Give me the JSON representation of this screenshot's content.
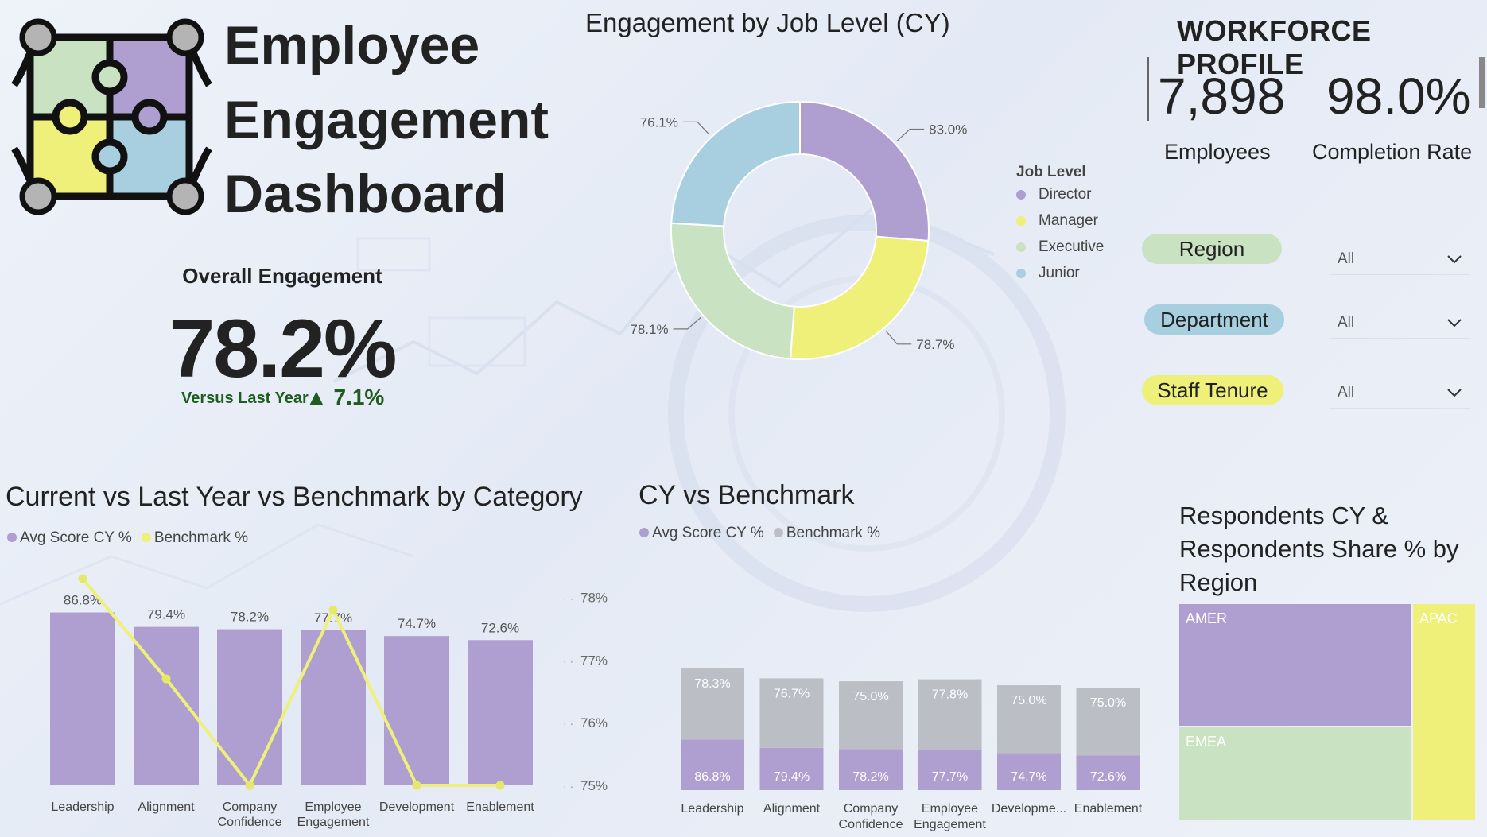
{
  "header": {
    "title_lines": [
      "Employee",
      "Engagement",
      "Dashboard"
    ]
  },
  "kpi": {
    "overall_label": "Overall Engagement",
    "overall_value": "78.2%",
    "vs_label": "Versus Last Year",
    "delta": "▲ 7.1%"
  },
  "colors": {
    "purple": "#ae9fd0",
    "yellow": "#eef07a",
    "green": "#c8e2c2",
    "blue": "#a8cfe0",
    "grey": "#bcbec6",
    "positive": "#1f5c1f"
  },
  "workforce": {
    "title": "WORKFORCE PROFILE",
    "employees_value": "7,898",
    "employees_label": "Employees",
    "completion_value": "98.0%",
    "completion_label": "Completion Rate"
  },
  "filters": [
    {
      "label": "Region",
      "value": "All",
      "color": "#c8e2c2"
    },
    {
      "label": "Department",
      "value": "All",
      "color": "#a8cfe0"
    },
    {
      "label": "Staff Tenure",
      "value": "All",
      "color": "#eef07a"
    }
  ],
  "donut": {
    "title": "Engagement by Job Level (CY)",
    "legend_title": "Job Level",
    "legend": [
      {
        "label": "Director",
        "color": "#ae9fd0"
      },
      {
        "label": "Manager",
        "color": "#eef07a"
      },
      {
        "label": "Executive",
        "color": "#c8e2c2"
      },
      {
        "label": "Junior",
        "color": "#a8cfe0"
      }
    ]
  },
  "category_chart": {
    "title": "Current vs Last Year vs Benchmark by Category",
    "legend": [
      {
        "label": "Avg Score CY %",
        "color": "#ae9fd0"
      },
      {
        "label": "Benchmark %",
        "color": "#eef07a"
      }
    ]
  },
  "cy_bench_chart": {
    "title": "CY vs Benchmark",
    "legend": [
      {
        "label": "Avg Score CY %",
        "color": "#ae9fd0"
      },
      {
        "label": "Benchmark %",
        "color": "#bcbec6"
      }
    ]
  },
  "treemap": {
    "title_lines": [
      "Respondents CY &",
      "Respondents Share % by",
      "Region"
    ]
  },
  "chart_data": [
    {
      "type": "pie",
      "title": "Engagement by Job Level (CY)",
      "categories": [
        "Director",
        "Manager",
        "Executive",
        "Junior"
      ],
      "values": [
        83.0,
        78.7,
        78.1,
        76.1
      ],
      "labels": [
        "83.0%",
        "78.7%",
        "78.1%",
        "76.1%"
      ]
    },
    {
      "type": "bar",
      "title": "Current vs Last Year vs Benchmark by Category",
      "categories": [
        "Leadership",
        "Alignment",
        "Company Confidence",
        "Employee Engagement",
        "Development",
        "Enablement"
      ],
      "category_label_lines": [
        [
          "Leadership"
        ],
        [
          "Alignment"
        ],
        [
          "Company",
          "Confidence"
        ],
        [
          "Employee",
          "Engagement"
        ],
        [
          "Development"
        ],
        [
          "Enablement"
        ]
      ],
      "series": [
        {
          "name": "Avg Score CY %",
          "values": [
            86.8,
            79.4,
            78.2,
            77.7,
            74.7,
            72.6
          ],
          "labels": [
            "86.8%",
            "79.4%",
            "78.2%",
            "77.7%",
            "74.7%",
            "72.6%"
          ]
        },
        {
          "name": "Benchmark %",
          "values": [
            78.3,
            76.7,
            75.0,
            77.8,
            75.0,
            75.0
          ],
          "axis": "secondary"
        }
      ],
      "ylim": [
        0,
        100
      ],
      "y2lim": [
        75,
        78.3
      ],
      "y2ticks": [
        "78%",
        "77%",
        "76%",
        "75%"
      ]
    },
    {
      "type": "bar",
      "title": "CY vs Benchmark",
      "categories": [
        "Leadership",
        "Alignment",
        "Company Confidence",
        "Employee Engagement",
        "Development",
        "Enablement"
      ],
      "category_label_lines": [
        [
          "Leadership"
        ],
        [
          "Alignment"
        ],
        [
          "Company",
          "Confidence"
        ],
        [
          "Employee",
          "Engagement"
        ],
        [
          "Developme..."
        ],
        [
          "Enablement"
        ]
      ],
      "stacked": true,
      "series": [
        {
          "name": "Avg Score CY %",
          "values": [
            86.8,
            79.4,
            78.2,
            77.7,
            74.7,
            72.6
          ],
          "labels": [
            "86.8%",
            "79.4%",
            "78.2%",
            "77.7%",
            "74.7%",
            "72.6%"
          ]
        },
        {
          "name": "Benchmark %",
          "values": [
            78.3,
            76.7,
            75.0,
            77.8,
            75.0,
            75.0
          ],
          "labels": [
            "78.3%",
            "76.7%",
            "75.0%",
            "77.8%",
            "75.0%",
            "75.0%"
          ]
        }
      ]
    },
    {
      "type": "heatmap",
      "title": "Respondents CY & Respondents Share % by Region",
      "categories": [
        "AMER",
        "EMEA",
        "APAC"
      ],
      "values": [
        45,
        34,
        21
      ]
    }
  ]
}
